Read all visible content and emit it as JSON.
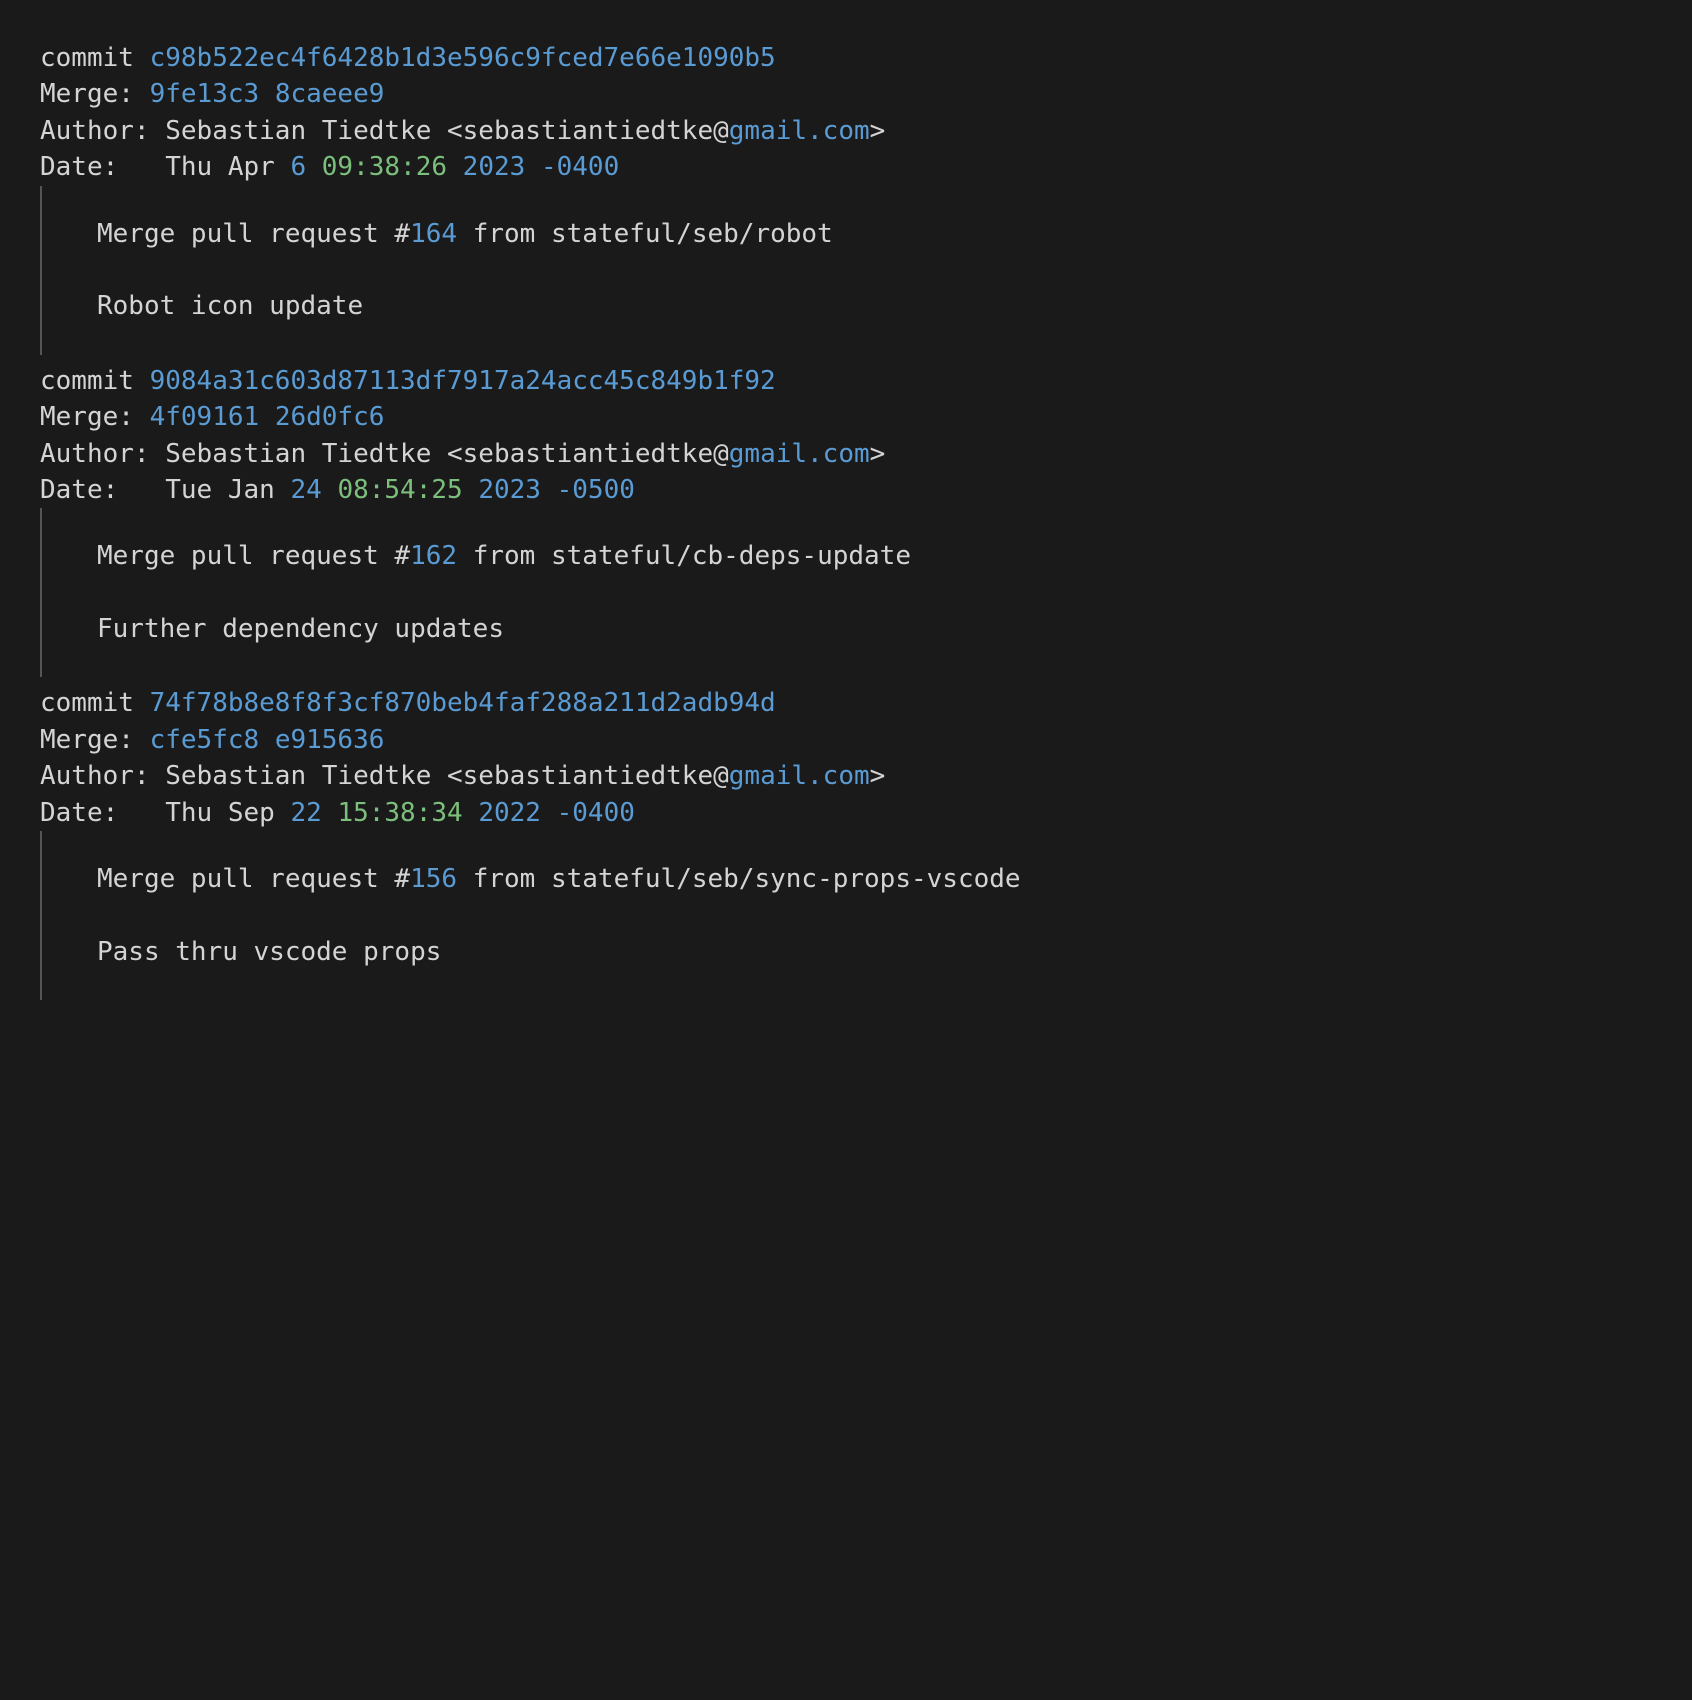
{
  "commits": [
    {
      "hash": "c98b522ec4f6428b1d3e596c9fced7e66e1090b5",
      "merge_a": "9fe13c3",
      "merge_b": "8caeee9",
      "author_name": "Sebastian Tiedtke",
      "author_email_local": "sebastiantiedtke",
      "author_email_domain": "gmail.com",
      "date_dow_month": "Thu Apr",
      "date_day": "6",
      "date_time": "09:38:26",
      "date_year": "2023",
      "date_tz": "-0400",
      "pr_prefix": "Merge pull request #",
      "pr_number": "164",
      "pr_suffix": " from stateful/seb/robot",
      "message": "Robot icon update"
    },
    {
      "hash": "9084a31c603d87113df7917a24acc45c849b1f92",
      "merge_a": "4f09161",
      "merge_b": "26d0fc6",
      "author_name": "Sebastian Tiedtke",
      "author_email_local": "sebastiantiedtke",
      "author_email_domain": "gmail.com",
      "date_dow_month": "Tue Jan",
      "date_day": "24",
      "date_time": "08:54:25",
      "date_year": "2023",
      "date_tz": "-0500",
      "pr_prefix": "Merge pull request #",
      "pr_number": "162",
      "pr_suffix": " from stateful/cb-deps-update",
      "message": "Further dependency updates"
    },
    {
      "hash": "74f78b8e8f8f3cf870beb4faf288a211d2adb94d",
      "merge_a": "cfe5fc8",
      "merge_b": "e915636",
      "author_name": "Sebastian Tiedtke",
      "author_email_local": "sebastiantiedtke",
      "author_email_domain": "gmail.com",
      "date_dow_month": "Thu Sep",
      "date_day": "22",
      "date_time": "15:38:34",
      "date_year": "2022",
      "date_tz": "-0400",
      "pr_prefix": "Merge pull request #",
      "pr_number": "156",
      "pr_suffix": " from stateful/seb/sync-props-vscode",
      "message": "Pass thru vscode props"
    }
  ],
  "labels": {
    "commit": "commit ",
    "merge": "Merge: ",
    "author": "Author: ",
    "date": "Date:   ",
    "email_at": "@",
    "email_open": " <",
    "email_close": ">",
    "space": " "
  }
}
